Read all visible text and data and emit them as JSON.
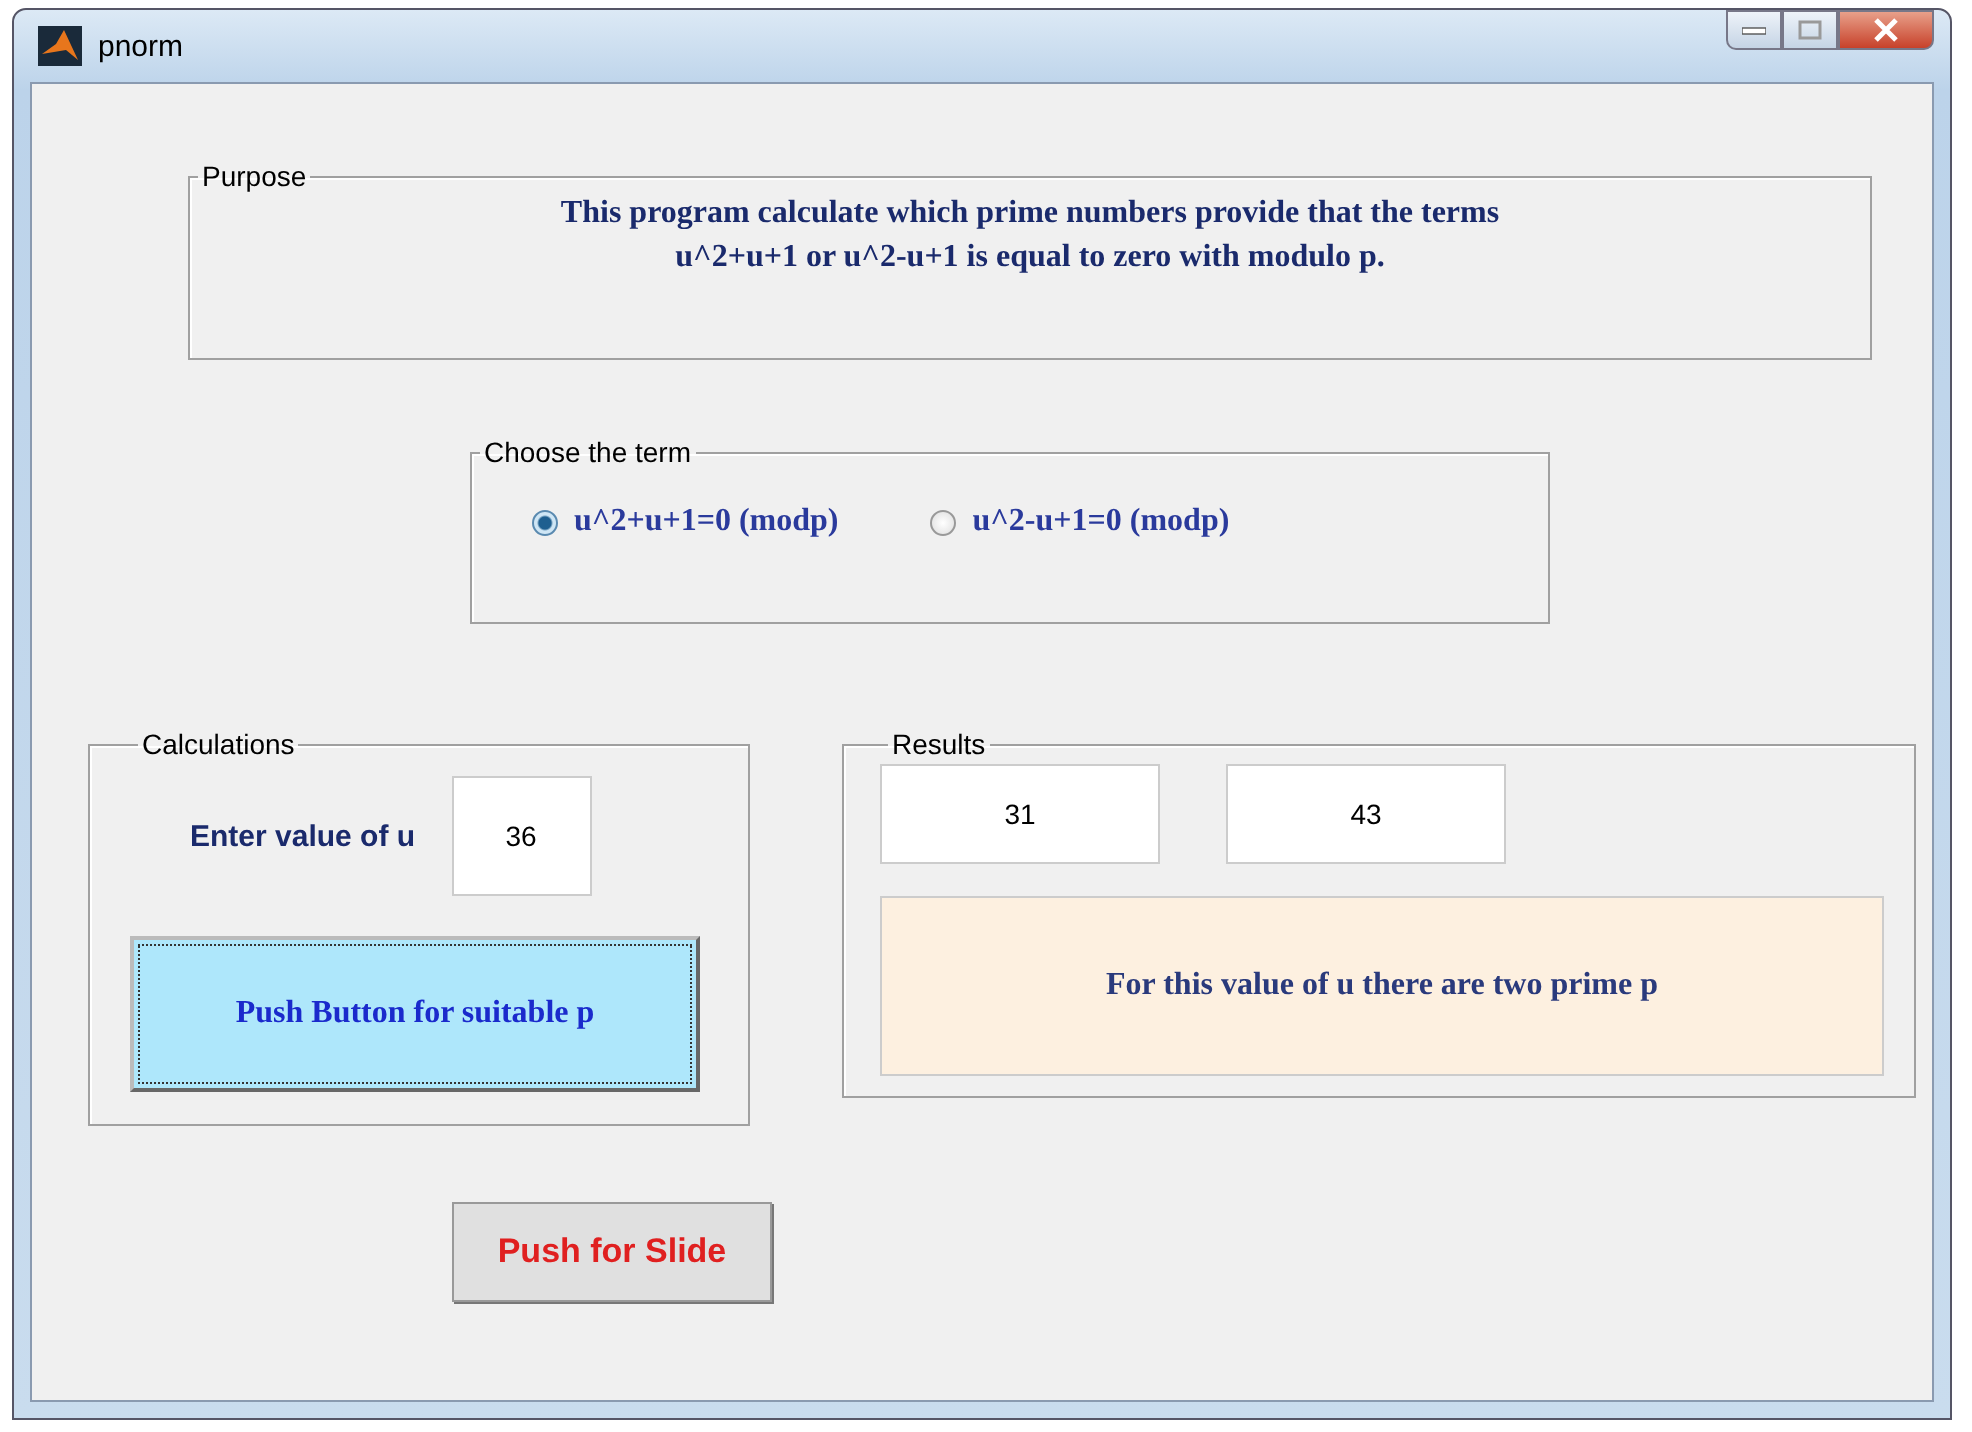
{
  "window": {
    "title": "pnorm"
  },
  "purpose": {
    "title": "Purpose",
    "text": "This program calculate which prime numbers provide that the terms\nu^2+u+1 or u^2-u+1 is equal to zero with modulo p."
  },
  "choose_term": {
    "title": "Choose the term",
    "options": [
      {
        "label": "u^2+u+1=0 (modp)",
        "selected": true
      },
      {
        "label": "u^2-u+1=0 (modp)",
        "selected": false
      }
    ]
  },
  "calculations": {
    "title": "Calculations",
    "label": "Enter value of u",
    "value": "36",
    "button": "Push Button for suitable p"
  },
  "results": {
    "title": "Results",
    "values": [
      "31",
      "43"
    ],
    "message": "For this value of u there are two prime p"
  },
  "slide_button": "Push for Slide"
}
